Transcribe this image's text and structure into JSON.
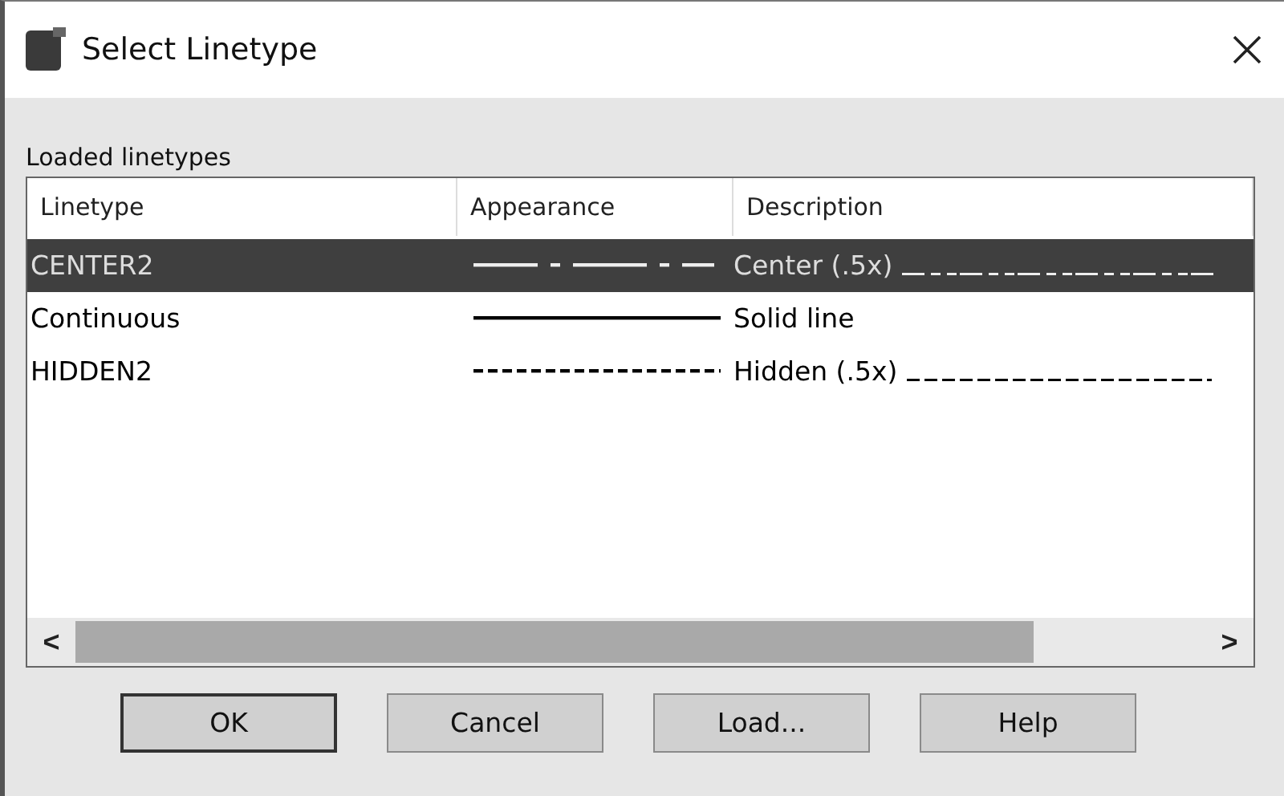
{
  "window": {
    "title": "Select Linetype"
  },
  "group_label": "Loaded linetypes",
  "table": {
    "columns": [
      "Linetype",
      "Appearance",
      "Description"
    ],
    "rows": [
      {
        "linetype": "CENTER2",
        "kind": "center",
        "description": "Center (.5x)",
        "selected": true
      },
      {
        "linetype": "Continuous",
        "kind": "solid",
        "description": "Solid line",
        "selected": false
      },
      {
        "linetype": "HIDDEN2",
        "kind": "hidden",
        "description": "Hidden (.5x)",
        "selected": false
      }
    ]
  },
  "scrollbar": {
    "left": "<",
    "right": ">"
  },
  "buttons": [
    {
      "label": "OK",
      "default": true
    },
    {
      "label": "Cancel",
      "default": false
    },
    {
      "label": "Load...",
      "default": false
    },
    {
      "label": "Help",
      "default": false
    }
  ]
}
